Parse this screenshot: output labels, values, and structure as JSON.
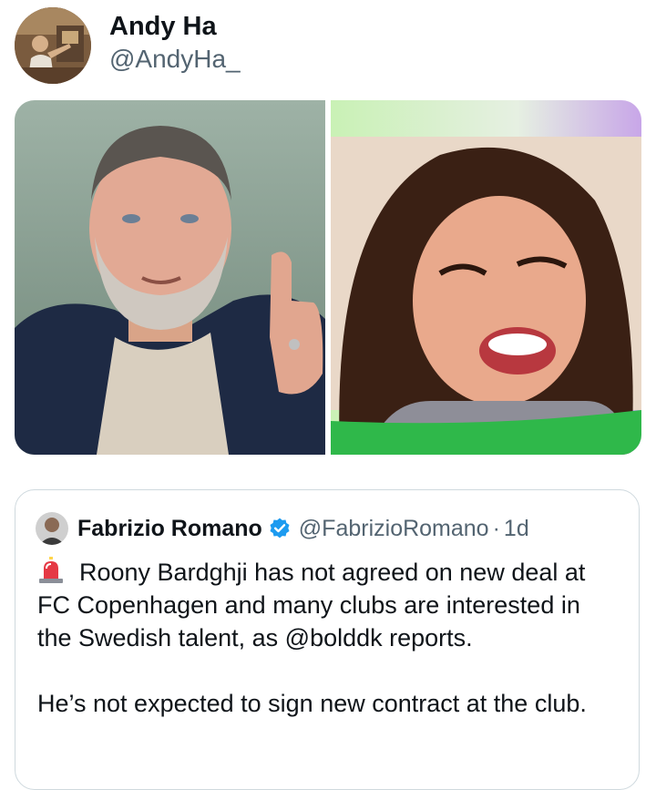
{
  "author": {
    "name": "Andy Ha",
    "handle": "@AndyHa_",
    "avatar_icon": "profile-photo"
  },
  "media": [
    {
      "label": "photo-man-thumbs-up"
    },
    {
      "label": "photo-woman-laughing"
    }
  ],
  "quoted": {
    "name": "Fabrizio Romano",
    "handle": "@FabrizioRomano",
    "separator": "·",
    "time": "1d",
    "verified_color": "#1d9bf0",
    "siren_icon": "police-siren-emoji",
    "body_line1": "Roony Bardghji has not agreed on new deal at FC Copenhagen and many clubs are interested in the Swedish talent, as @bolddk reports.",
    "body_line2": "He’s not expected to sign new contract at the club."
  },
  "colors": {
    "text": "#0f1419",
    "secondary": "#536471",
    "border": "#cfd9de",
    "accent": "#1d9bf0"
  }
}
